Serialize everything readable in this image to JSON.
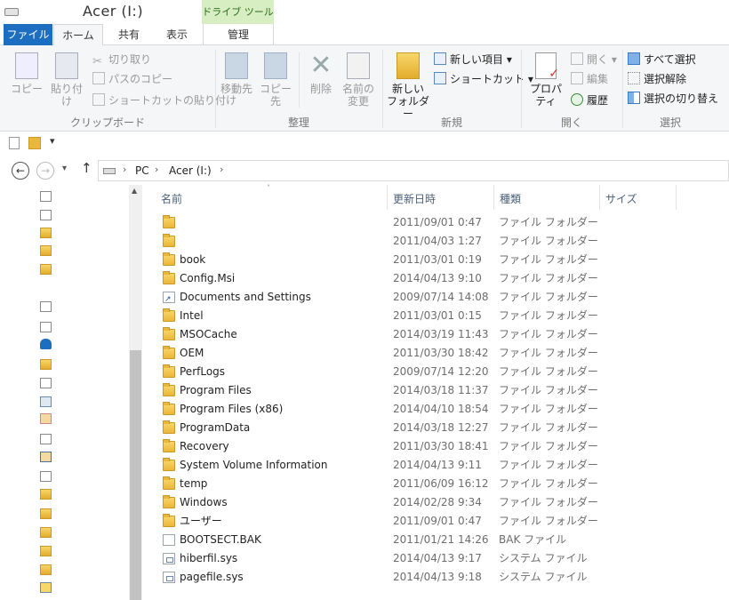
{
  "window": {
    "title": "Acer (I:)",
    "drive_tools_label": "ドライブ ツール"
  },
  "tabs": {
    "file": "ファイル",
    "home": "ホーム",
    "share": "共有",
    "view": "表示",
    "manage": "管理"
  },
  "ribbon": {
    "clipboard": {
      "copy": "コピー",
      "paste": "貼り付け",
      "cut": "切り取り",
      "copy_path": "パスのコピー",
      "paste_shortcut": "ショートカットの貼り付け",
      "label": "クリップボード"
    },
    "organize": {
      "move_to": "移動先",
      "copy_to": "コピー先",
      "delete": "削除",
      "rename_line1": "名前の",
      "rename_line2": "変更",
      "label": "整理"
    },
    "new": {
      "new_folder_line1": "新しい",
      "new_folder_line2": "フォルダー",
      "new_item": "新しい項目",
      "shortcut": "ショートカット",
      "label": "新規"
    },
    "open": {
      "properties": "プロパティ",
      "open": "開く",
      "edit": "編集",
      "history": "履歴",
      "label": "開く"
    },
    "select": {
      "select_all": "すべて選択",
      "select_none": "選択解除",
      "invert": "選択の切り替え",
      "label": "選択"
    }
  },
  "address": {
    "pc": "PC",
    "drive": "Acer (I:)"
  },
  "columns": {
    "name": "名前",
    "date": "更新日時",
    "type": "種類",
    "size": "サイズ"
  },
  "files": [
    {
      "name": "",
      "date": "2011/09/01 0:47",
      "type": "ファイル フォルダー",
      "icon": "folder-icon"
    },
    {
      "name": "",
      "date": "2011/04/03 1:27",
      "type": "ファイル フォルダー",
      "icon": "folder-icon"
    },
    {
      "name": "book",
      "date": "2011/03/01 0:19",
      "type": "ファイル フォルダー",
      "icon": "folder-icon"
    },
    {
      "name": "Config.Msi",
      "date": "2014/04/13 9:10",
      "type": "ファイル フォルダー",
      "icon": "folder-icon"
    },
    {
      "name": "Documents and Settings",
      "date": "2009/07/14 14:08",
      "type": "ファイル フォルダー",
      "icon": "shortcut-folder-icon"
    },
    {
      "name": "Intel",
      "date": "2011/03/01 0:15",
      "type": "ファイル フォルダー",
      "icon": "folder-icon"
    },
    {
      "name": "MSOCache",
      "date": "2014/03/19 11:43",
      "type": "ファイル フォルダー",
      "icon": "folder-icon"
    },
    {
      "name": "OEM",
      "date": "2011/03/30 18:42",
      "type": "ファイル フォルダー",
      "icon": "folder-icon"
    },
    {
      "name": "PerfLogs",
      "date": "2009/07/14 12:20",
      "type": "ファイル フォルダー",
      "icon": "folder-icon"
    },
    {
      "name": "Program Files",
      "date": "2014/03/18 11:37",
      "type": "ファイル フォルダー",
      "icon": "folder-icon"
    },
    {
      "name": "Program Files (x86)",
      "date": "2014/04/10 18:54",
      "type": "ファイル フォルダー",
      "icon": "folder-icon"
    },
    {
      "name": "ProgramData",
      "date": "2014/03/18 12:27",
      "type": "ファイル フォルダー",
      "icon": "folder-icon"
    },
    {
      "name": "Recovery",
      "date": "2011/03/30 18:41",
      "type": "ファイル フォルダー",
      "icon": "folder-icon"
    },
    {
      "name": "System Volume Information",
      "date": "2014/04/13 9:11",
      "type": "ファイル フォルダー",
      "icon": "folder-icon"
    },
    {
      "name": "temp",
      "date": "2011/06/09 16:12",
      "type": "ファイル フォルダー",
      "icon": "folder-icon"
    },
    {
      "name": "Windows",
      "date": "2014/02/28 9:34",
      "type": "ファイル フォルダー",
      "icon": "folder-icon"
    },
    {
      "name": "ユーザー",
      "date": "2011/09/01 0:47",
      "type": "ファイル フォルダー",
      "icon": "folder-icon"
    },
    {
      "name": "BOOTSECT.BAK",
      "date": "2011/01/21 14:26",
      "type": "BAK ファイル",
      "icon": "file-icon"
    },
    {
      "name": "hiberfil.sys",
      "date": "2014/04/13 9:17",
      "type": "システム ファイル",
      "icon": "system-file-icon"
    },
    {
      "name": "pagefile.sys",
      "date": "2014/04/13 9:18",
      "type": "システム ファイル",
      "icon": "system-file-icon"
    }
  ],
  "nav_items": [
    "shortcut-icon",
    "shortcut-icon",
    "folder-icon",
    "folder-icon",
    "folder-icon",
    "shortcut-icon",
    "shortcut-icon",
    "onedrive-icon",
    "folder-icon",
    "shortcut-icon",
    "network-icon",
    "recycle-icon",
    "shortcut-icon",
    "user-icon",
    "shortcut-icon",
    "folder-icon",
    "folder-icon",
    "folder-icon",
    "folder-icon",
    "folder-icon",
    "library-icon",
    "favorites-icon"
  ]
}
